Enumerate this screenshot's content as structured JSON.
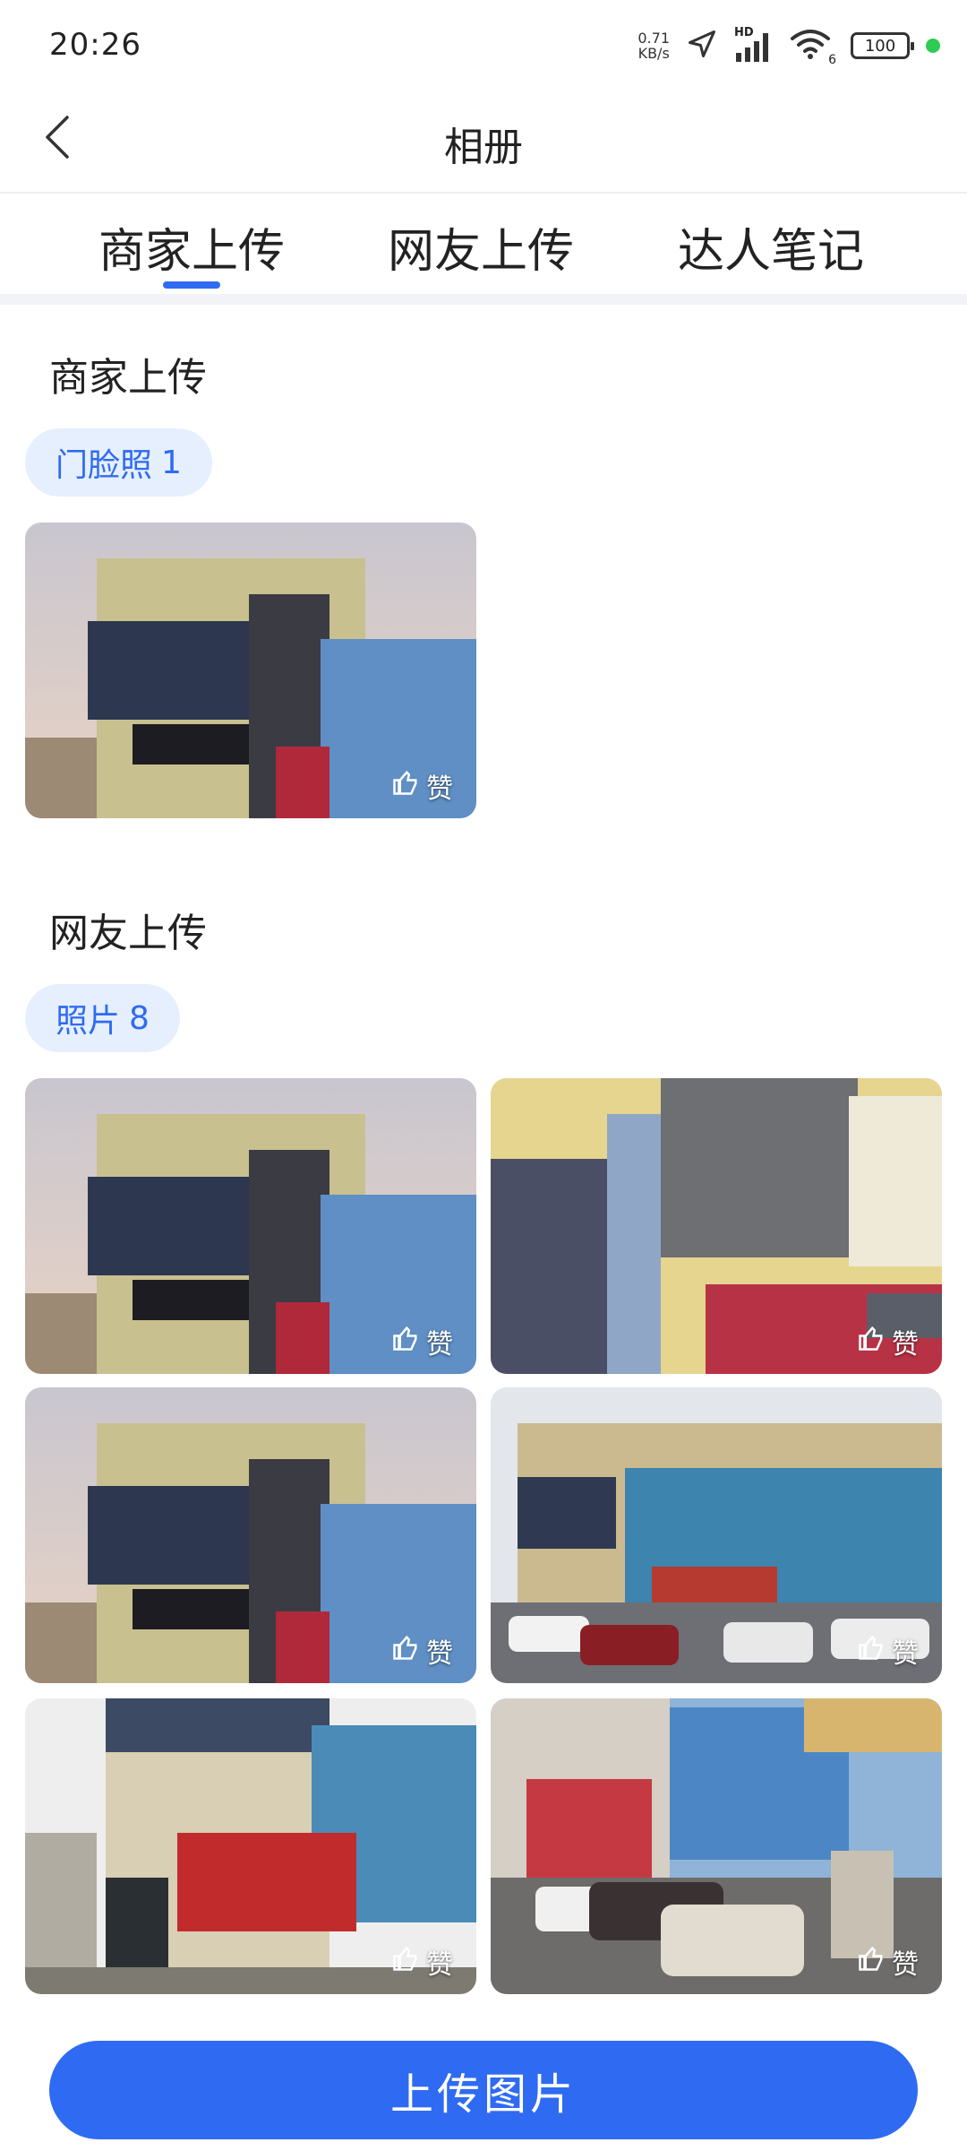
{
  "status_bar": {
    "time": "20:26",
    "net_speed_value": "0.71",
    "net_speed_unit": "KB/s",
    "hd_label": "HD",
    "wifi_badge": "6",
    "battery": "100"
  },
  "nav": {
    "title": "相册"
  },
  "tabs": [
    {
      "label": "商家上传",
      "active": true
    },
    {
      "label": "网友上传",
      "active": false
    },
    {
      "label": "达人笔记",
      "active": false
    }
  ],
  "merchant_section": {
    "title": "商家上传",
    "pill_label": "门脸照",
    "pill_count": "1",
    "photos": [
      {
        "like_label": "赞",
        "variant": "dusk-building"
      }
    ]
  },
  "user_section": {
    "title": "网友上传",
    "pill_label": "照片",
    "pill_count": "8",
    "photos": [
      {
        "like_label": "赞",
        "variant": "dusk-building"
      },
      {
        "like_label": "赞",
        "variant": "facade-closeup"
      },
      {
        "like_label": "赞",
        "variant": "dusk-building"
      },
      {
        "like_label": "赞",
        "variant": "hotel-parking"
      },
      {
        "like_label": "赞",
        "variant": "storefront"
      },
      {
        "like_label": "赞",
        "variant": "street-cars"
      }
    ]
  },
  "footer": {
    "upload_label": "上传图片"
  },
  "colors": {
    "accent": "#2f6bf2",
    "pill_bg": "#e6effe"
  }
}
